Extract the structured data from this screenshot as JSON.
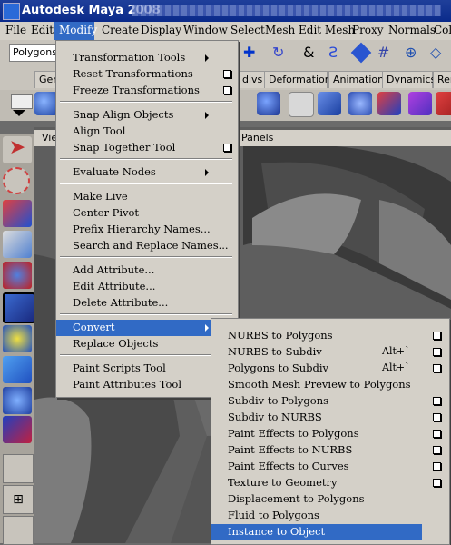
{
  "titlebar": {
    "title": "Autodesk Maya 2008"
  },
  "menubar": {
    "items": [
      "File",
      "Edit",
      "Modify",
      "Create",
      "Display",
      "Window",
      "Select",
      "Mesh",
      "Edit Mesh",
      "Proxy",
      "Normals",
      "Col"
    ]
  },
  "shelf": {
    "menuset": "Polygons",
    "tabs": [
      "Gen",
      "divs",
      "Deformation",
      "Animation",
      "Dynamics",
      "Ren"
    ]
  },
  "panel": {
    "view_label": "Vie",
    "panels_label": "Panels"
  },
  "modify_menu": {
    "items": [
      {
        "label": "Transformation Tools",
        "submenu": true,
        "option": false
      },
      {
        "label": "Reset Transformations",
        "submenu": false,
        "option": true
      },
      {
        "label": "Freeze Transformations",
        "submenu": false,
        "option": true
      },
      {
        "sep": true
      },
      {
        "label": "Snap Align Objects",
        "submenu": true,
        "option": false
      },
      {
        "label": "Align Tool",
        "submenu": false,
        "option": false
      },
      {
        "label": "Snap Together Tool",
        "submenu": false,
        "option": true
      },
      {
        "sep": true
      },
      {
        "label": "Evaluate Nodes",
        "submenu": true,
        "option": false
      },
      {
        "sep": true
      },
      {
        "label": "Make Live",
        "submenu": false,
        "option": false
      },
      {
        "label": "Center Pivot",
        "submenu": false,
        "option": false
      },
      {
        "label": "Prefix Hierarchy Names...",
        "submenu": false,
        "option": false
      },
      {
        "label": "Search and Replace Names...",
        "submenu": false,
        "option": false
      },
      {
        "sep": true
      },
      {
        "label": "Add Attribute...",
        "submenu": false,
        "option": false
      },
      {
        "label": "Edit Attribute...",
        "submenu": false,
        "option": false
      },
      {
        "label": "Delete Attribute...",
        "submenu": false,
        "option": false
      },
      {
        "sep": true
      },
      {
        "label": "Convert",
        "submenu": true,
        "option": false,
        "highlight": true
      },
      {
        "label": "Replace Objects",
        "submenu": false,
        "option": false
      },
      {
        "sep": true
      },
      {
        "label": "Paint Scripts Tool",
        "submenu": false,
        "option": false
      },
      {
        "label": "Paint Attributes Tool",
        "submenu": false,
        "option": false
      }
    ]
  },
  "convert_menu": {
    "items": [
      {
        "label": "NURBS to Polygons",
        "accel": "",
        "option": true
      },
      {
        "label": "NURBS to Subdiv",
        "accel": "Alt+`",
        "option": true
      },
      {
        "label": "Polygons to Subdiv",
        "accel": "Alt+`",
        "option": true
      },
      {
        "label": "Smooth Mesh Preview to Polygons",
        "accel": "",
        "option": false
      },
      {
        "label": "Subdiv to Polygons",
        "accel": "",
        "option": true
      },
      {
        "label": "Subdiv to NURBS",
        "accel": "",
        "option": true
      },
      {
        "label": "Paint Effects to Polygons",
        "accel": "",
        "option": true
      },
      {
        "label": "Paint Effects to NURBS",
        "accel": "",
        "option": true
      },
      {
        "label": "Paint Effects to Curves",
        "accel": "",
        "option": true
      },
      {
        "label": "Texture to Geometry",
        "accel": "",
        "option": true
      },
      {
        "label": "Displacement to Polygons",
        "accel": "",
        "option": false
      },
      {
        "label": "Fluid to Polygons",
        "accel": "",
        "option": false
      },
      {
        "label": "Instance to Object",
        "accel": "",
        "option": false,
        "highlight": true
      }
    ]
  },
  "colors": {
    "highlight": "#316ac5",
    "menu_bg": "#d4d0c8",
    "title_bg": "#0a2a8a"
  }
}
